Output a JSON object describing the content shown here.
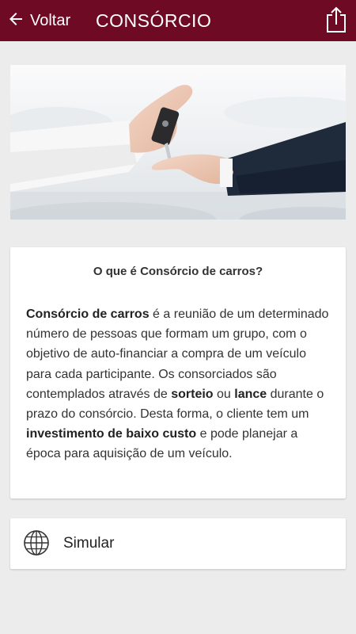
{
  "colors": {
    "header_bg": "#6e0a23",
    "header_text": "#ffffff",
    "page_bg": "#ececec",
    "card_bg": "#ffffff"
  },
  "header": {
    "back_label": "Voltar",
    "title": "CONSÓRCIO",
    "back_icon": "arrow-left-icon",
    "share_icon": "share-icon"
  },
  "hero": {
    "image": "photo of one hand passing car keys to another hand"
  },
  "info": {
    "heading": "O que é Consórcio de carros?",
    "p_bold_1": "Consórcio  de carros",
    "p_text_1": " é a reunião de um determinado número de pessoas que formam um grupo, com o objetivo de auto-financiar a compra de um veículo para cada participante. Os consorciados são contemplados através de ",
    "p_bold_2": "sorteio",
    "p_text_2": " ou ",
    "p_bold_3": "lance",
    "p_text_3": " durante o prazo do consórcio. Desta forma, o cliente tem um ",
    "p_bold_4": "investimento de baixo custo",
    "p_text_4": " e pode planejar a época para aquisição de um veículo."
  },
  "action": {
    "label": "Simular",
    "icon": "globe-icon"
  }
}
